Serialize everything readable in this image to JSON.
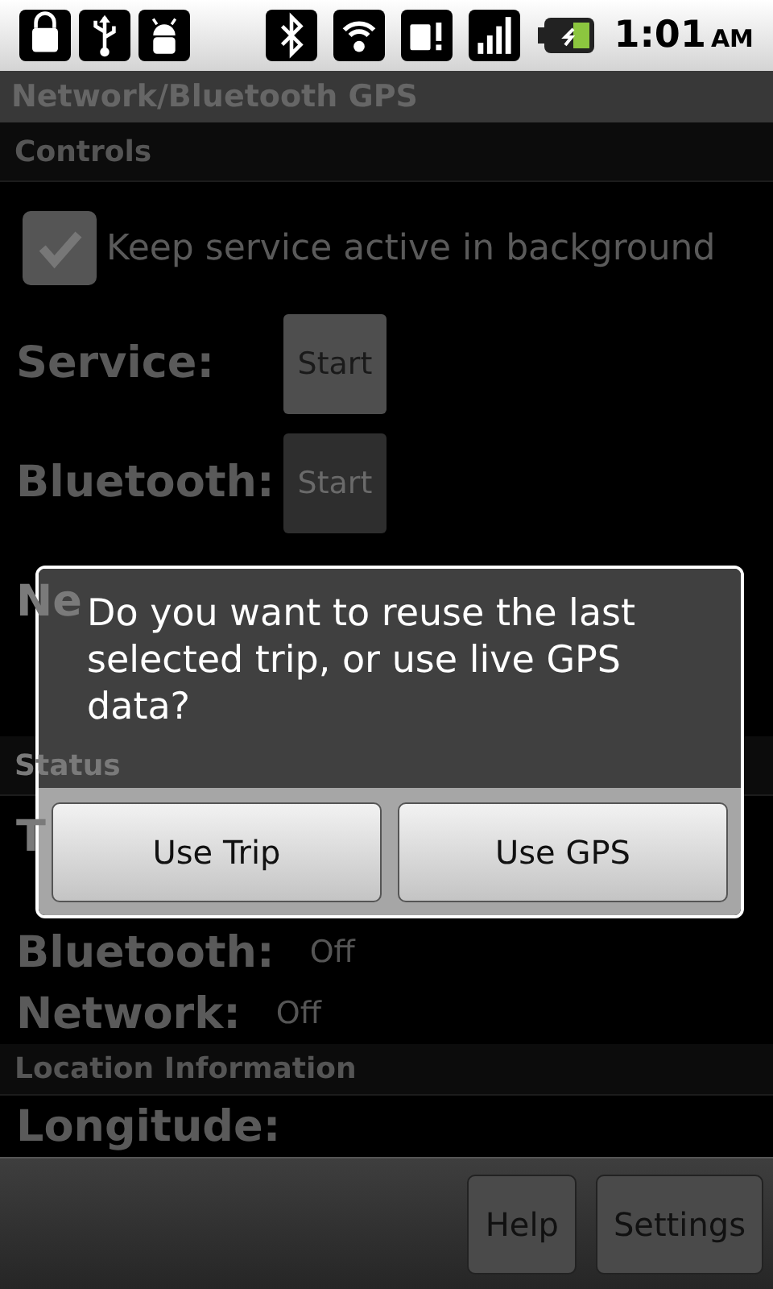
{
  "status_bar": {
    "time": "1:01",
    "meridiem": "AM"
  },
  "title": "Network/Bluetooth GPS",
  "sections": [
    {
      "header": "Controls",
      "items": [
        {
          "kind": "checkbox",
          "label": "Keep service active in background",
          "checked": true
        },
        {
          "kind": "control",
          "label": "Service:",
          "button": "Start",
          "disabled": false
        },
        {
          "kind": "control",
          "label": "Bluetooth:",
          "button": "Start",
          "disabled": true
        },
        {
          "kind": "control",
          "label": "Ne"
        }
      ]
    },
    {
      "header": "Status",
      "items": [
        {
          "kind": "status",
          "label": "T"
        },
        {
          "kind": "status",
          "label": "Bluetooth:",
          "value": "Off"
        },
        {
          "kind": "status",
          "label": "Network:",
          "value": "Off"
        }
      ]
    },
    {
      "header": "Location Information",
      "items": [
        {
          "kind": "status",
          "label": "Longitude:"
        }
      ]
    }
  ],
  "dialog": {
    "message": "Do you want to reuse the last selected trip, or use live GPS data?",
    "buttons": [
      "Use Trip",
      "Use GPS"
    ]
  },
  "footer_buttons": [
    "Help",
    "Settings"
  ]
}
